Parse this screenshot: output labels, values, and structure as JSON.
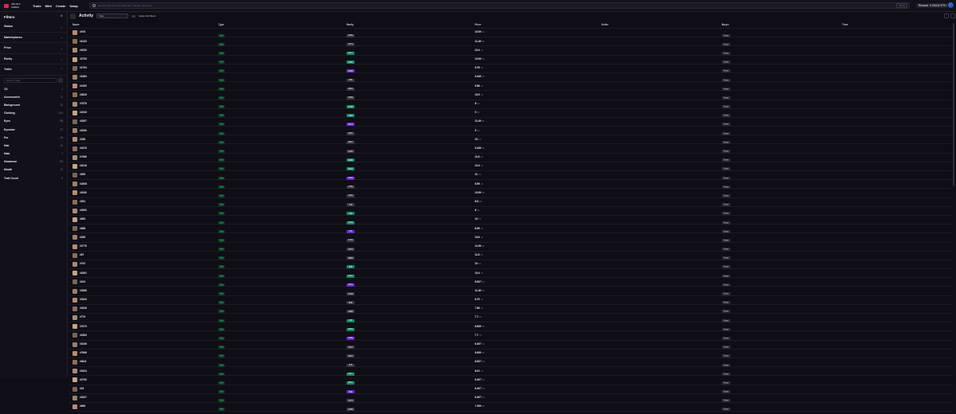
{
  "topbar": {
    "logo": "MAGIC EDEN",
    "nav": [
      "Trade",
      "Mint",
      "Create",
      "Swap"
    ],
    "search_placeholder": "Search collections on Ethereum, Solana, and more",
    "search_shortcut": "Ctrl K",
    "rewards": "Rewards",
    "wallet": "0.00042 ETH"
  },
  "sidebar": {
    "title": "Filters",
    "sections": [
      "Status",
      "Marketplaces",
      "Price",
      "Rarity",
      "Traits"
    ],
    "trait_search_placeholder": "Search Traits",
    "traits": [
      {
        "label": "1/1",
        "count": "1"
      },
      {
        "label": "Accessories",
        "count": "71"
      },
      {
        "label": "Background",
        "count": "32"
      },
      {
        "label": "Clothing",
        "count": "101"
      },
      {
        "label": "Eyes",
        "count": "88"
      },
      {
        "label": "Eyewear",
        "count": "27"
      },
      {
        "label": "Fur",
        "count": "45"
      },
      {
        "label": "Hair",
        "count": "24"
      },
      {
        "label": "Hats",
        "count": "7"
      },
      {
        "label": "Headwear",
        "count": "82"
      },
      {
        "label": "Mouth",
        "count": "17"
      },
      {
        "label": "Trait Count",
        "count": "6"
      }
    ]
  },
  "main": {
    "title": "Activity",
    "filter_select": "Sale",
    "apply_label": "Apply trait filters",
    "headers": [
      "Name",
      "Type",
      "Rarity",
      "Price",
      "Seller",
      "Buyer",
      "Time"
    ],
    "rows": [
      {
        "name": "#976",
        "rarity": "2283",
        "price": "10.99",
        "tag": "2%"
      },
      {
        "name": "#1023",
        "rarity": "3774",
        "price": "11.49",
        "tag": "5%"
      },
      {
        "name": "#3330",
        "rarity": "1017",
        "price": "10.4",
        "tag": "4%"
      },
      {
        "name": "#2753",
        "rarity": "1982",
        "price": "10.99",
        "tag": "2%"
      },
      {
        "name": "#2794",
        "rarity": "4406",
        "price": "9.78",
        "tag": "6%"
      },
      {
        "name": "#1683",
        "rarity": "306",
        "price": "9.449",
        "tag": "1%"
      },
      {
        "name": "#1900",
        "rarity": "2810",
        "price": "9.88",
        "tag": "6%"
      },
      {
        "name": "#3625",
        "rarity": "3309",
        "price": "10.5",
        "tag": "4%"
      },
      {
        "name": "#7675",
        "rarity": "1049",
        "price": "8",
        "tag": "1%"
      },
      {
        "name": "#2343",
        "rarity": "3119",
        "price": "9",
        "tag": "2%"
      },
      {
        "name": "#3397",
        "rarity": "3274",
        "price": "11.49",
        "tag": "5%"
      },
      {
        "name": "#3390",
        "rarity": "3257",
        "price": "9",
        "tag": "1%"
      },
      {
        "name": "#338",
        "rarity": "3527",
        "price": "10",
        "tag": "2%"
      },
      {
        "name": "#3376",
        "rarity": "1251",
        "price": "9.439",
        "tag": "3%"
      },
      {
        "name": "#7966",
        "rarity": "2996",
        "price": "11.6",
        "tag": "4%"
      },
      {
        "name": "#3316",
        "rarity": "3301",
        "price": "10.4",
        "tag": "5%"
      },
      {
        "name": "#939",
        "rarity": "3263",
        "price": "11",
        "tag": "2%"
      },
      {
        "name": "#3308",
        "rarity": "2769",
        "price": "8.99",
        "tag": "2%"
      },
      {
        "name": "#3330",
        "rarity": "1194",
        "price": "10.99",
        "tag": "4%"
      },
      {
        "name": "#391",
        "rarity": "716",
        "price": "8.8",
        "tag": "2%"
      },
      {
        "name": "#3300",
        "rarity": "104",
        "price": "8",
        "tag": "1%"
      },
      {
        "name": "#653",
        "rarity": "1034",
        "price": "10",
        "tag": "3%"
      },
      {
        "name": "#388",
        "rarity": "761",
        "price": "8.05",
        "tag": "3%"
      },
      {
        "name": "#339",
        "rarity": "1264",
        "price": "10.6",
        "tag": "4%"
      },
      {
        "name": "#3775",
        "rarity": "3270",
        "price": "11.99",
        "tag": "2%"
      },
      {
        "name": "#87",
        "rarity": "3806",
        "price": "11.8",
        "tag": "3%"
      },
      {
        "name": "#702",
        "rarity": "846",
        "price": "10",
        "tag": "2%"
      },
      {
        "name": "#1891",
        "rarity": "1027",
        "price": "10.4",
        "tag": "4%"
      },
      {
        "name": "#103",
        "rarity": "3831",
        "price": "8.537",
        "tag": "3%"
      },
      {
        "name": "#3368",
        "rarity": "1003",
        "price": "11.49",
        "tag": "5%"
      },
      {
        "name": "#3344",
        "rarity": "526",
        "price": "8.79",
        "tag": "2%"
      },
      {
        "name": "#3326",
        "rarity": "3268",
        "price": "7.89",
        "tag": "2%"
      },
      {
        "name": "#776",
        "rarity": "426",
        "price": "7.7",
        "tag": "2%"
      },
      {
        "name": "#7673",
        "rarity": "2091",
        "price": "8.639",
        "tag": "3%"
      },
      {
        "name": "#3363",
        "rarity": "1983",
        "price": "7.7",
        "tag": "1%"
      },
      {
        "name": "#3336",
        "rarity": "3372",
        "price": "6.497",
        "tag": "2%"
      },
      {
        "name": "#7666",
        "rarity": "3321",
        "price": "8.639",
        "tag": "3%"
      },
      {
        "name": "#3611",
        "rarity": "376",
        "price": "8.537",
        "tag": "3%"
      },
      {
        "name": "#3324",
        "rarity": "3317",
        "price": "8.01",
        "tag": "2%"
      },
      {
        "name": "#2752",
        "rarity": "2827",
        "price": "6.497",
        "tag": "2%"
      },
      {
        "name": "#33",
        "rarity": "634",
        "price": "6.497",
        "tag": "3%"
      },
      {
        "name": "#3327",
        "rarity": "1074",
        "price": "6.497",
        "tag": "2%"
      },
      {
        "name": "#666",
        "rarity": "1055",
        "price": "7.399",
        "tag": "2%"
      }
    ],
    "type_label": "Sale",
    "buyer_label": "Swap"
  }
}
